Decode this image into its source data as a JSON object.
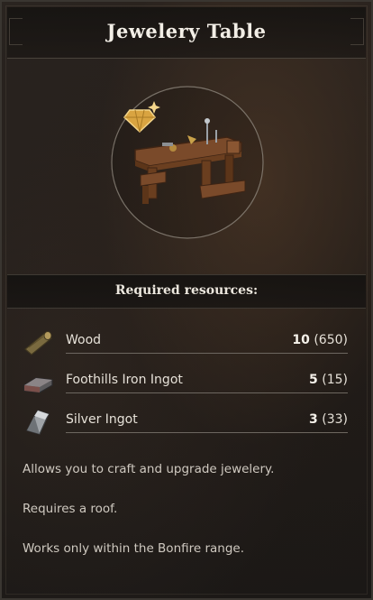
{
  "window": {
    "title": "Jewelery Table"
  },
  "requirements": {
    "header": "Required resources:",
    "items": [
      {
        "name": "Wood",
        "required": "10",
        "owned": "(650)",
        "icon": "wood-log-icon"
      },
      {
        "name": "Foothills Iron Ingot",
        "required": "5",
        "owned": "(15)",
        "icon": "iron-ingot-icon"
      },
      {
        "name": "Silver Ingot",
        "required": "3",
        "owned": "(33)",
        "icon": "silver-ingot-icon"
      }
    ]
  },
  "description": [
    "Allows you to craft and upgrade jewelery.",
    "Requires a roof.",
    "Works only within the Bonfire range."
  ],
  "colors": {
    "accent_gold": "#d9a441",
    "text": "#e6e1d8"
  }
}
